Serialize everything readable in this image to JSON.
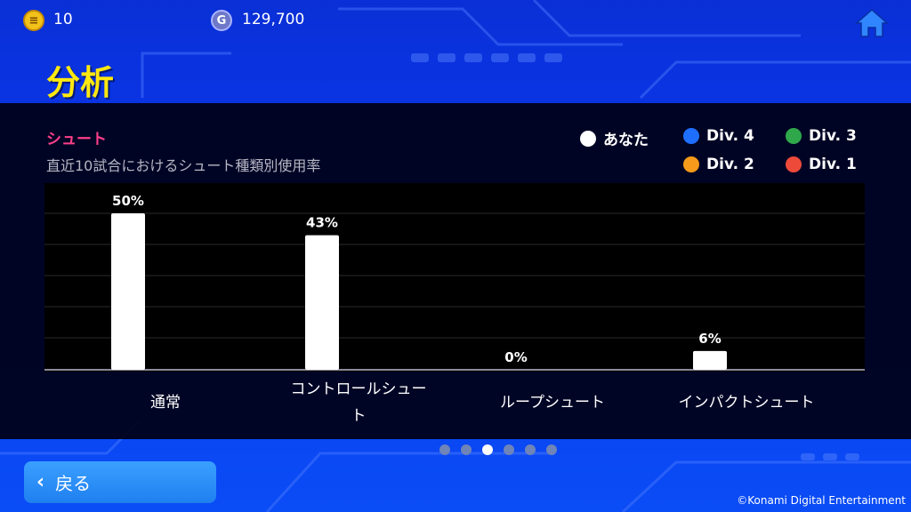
{
  "topbar": {
    "coin_value": "10",
    "coin_icon": "yellow-coin-icon",
    "gold_value": "129,700",
    "gold_icon": "g-coin-icon",
    "gold_icon_letter": "G",
    "home_icon": "home-icon"
  },
  "page": {
    "title": "分析"
  },
  "section": {
    "title": "シュート",
    "subtitle": "直近10試合におけるシュート種類別使用率"
  },
  "legend": [
    {
      "label": "あなた",
      "color": "#ffffff"
    },
    {
      "label": "Div. 4",
      "color": "#1e6fff"
    },
    {
      "label": "Div. 3",
      "color": "#2ea84a"
    },
    {
      "label": "Div. 2",
      "color": "#f59a1a"
    },
    {
      "label": "Div. 1",
      "color": "#ee4a3a"
    }
  ],
  "chart_data": {
    "type": "bar",
    "categories": [
      "通常",
      "コントロールシュート",
      "ループシュート",
      "インパクトシュート"
    ],
    "series": [
      {
        "name": "あなた",
        "values": [
          50,
          43,
          0,
          6
        ],
        "color": "#ffffff"
      }
    ],
    "value_labels": [
      "50%",
      "43%",
      "0%",
      "6%"
    ],
    "ylim": [
      0,
      50
    ],
    "grid": true
  },
  "category_labels": [
    "通常",
    "コントロールシュー\nト",
    "ループシュート",
    "インパクトシュート"
  ],
  "pagination": {
    "count": 6,
    "active_index": 2
  },
  "back_button": {
    "label": "戻る"
  },
  "footer": {
    "copyright": "©Konami Digital Entertainment"
  }
}
